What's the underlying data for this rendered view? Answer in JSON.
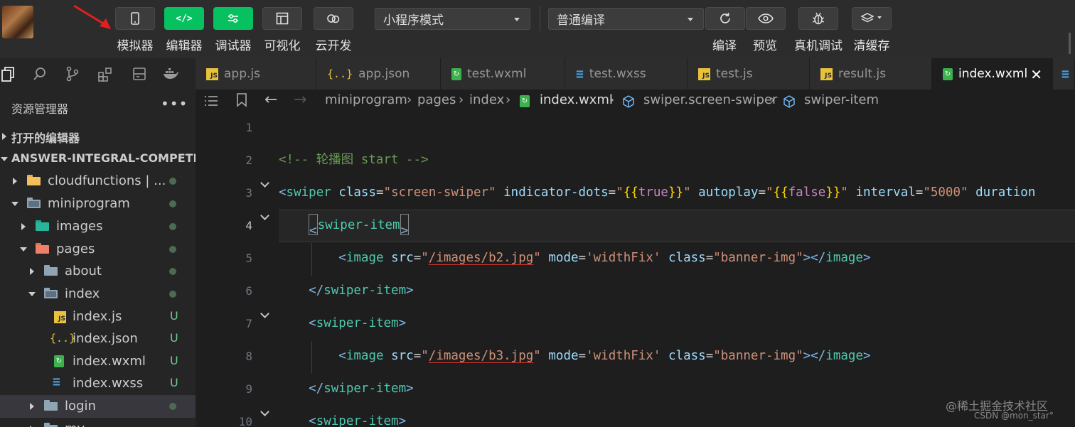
{
  "toolbar": {
    "buttons": [
      {
        "label": "模拟器",
        "icon": "phone-icon",
        "style": "gray"
      },
      {
        "label": "编辑器",
        "icon": "code-icon",
        "style": "green"
      },
      {
        "label": "调试器",
        "icon": "debugger-icon",
        "style": "green"
      },
      {
        "label": "可视化",
        "icon": "layout-icon",
        "style": "gray"
      },
      {
        "label": "云开发",
        "icon": "cloud-icon",
        "style": "gray"
      }
    ],
    "mode_select": "小程序模式",
    "compile_select": "普通编译",
    "actions": [
      {
        "label": "编译",
        "icon": "refresh-icon"
      },
      {
        "label": "预览",
        "icon": "eye-icon"
      },
      {
        "label": "真机调试",
        "icon": "bug-icon"
      },
      {
        "label": "清缓存",
        "icon": "layers-icon"
      }
    ]
  },
  "activity_icons": [
    "files-icon",
    "search-icon",
    "source-control-icon",
    "extensions-icon",
    "storage-icon",
    "docker-icon"
  ],
  "tabs": [
    {
      "label": "app.js",
      "type": "js"
    },
    {
      "label": "app.json",
      "type": "json"
    },
    {
      "label": "test.wxml",
      "type": "wxml"
    },
    {
      "label": "test.wxss",
      "type": "wxss"
    },
    {
      "label": "test.js",
      "type": "js"
    },
    {
      "label": "result.js",
      "type": "js"
    },
    {
      "label": "index.wxml",
      "type": "wxml",
      "active": true,
      "close": "✕"
    }
  ],
  "sidebar": {
    "title": "资源管理器",
    "more": "•••",
    "open_editors": "打开的编辑器",
    "project": "ANSWER-INTEGRAL-COMPETITI...",
    "tree": [
      {
        "label": "cloudfunctions | ...",
        "status": "dot"
      },
      {
        "label": "miniprogram",
        "status": "dot"
      },
      {
        "label": "images",
        "status": "dot"
      },
      {
        "label": "pages",
        "status": "dot"
      },
      {
        "label": "about",
        "status": "dot"
      },
      {
        "label": "index",
        "status": "dot"
      },
      {
        "label": "index.js",
        "status": "U"
      },
      {
        "label": "index.json",
        "status": "U"
      },
      {
        "label": "index.wxml",
        "status": "U"
      },
      {
        "label": "index.wxss",
        "status": "U"
      },
      {
        "label": "login",
        "status": "dot"
      },
      {
        "label": "my",
        "status": ""
      }
    ]
  },
  "breadcrumb": [
    "miniprogram",
    "pages",
    "index",
    "index.wxml",
    "swiper.screen-swiper",
    "swiper-item"
  ],
  "editor": {
    "line_numbers": [
      "1",
      "2",
      "3",
      "4",
      "5",
      "6",
      "7",
      "8",
      "9",
      "10"
    ],
    "current_line": "4"
  },
  "watermark": {
    "site": "@稀土掘金技术社区",
    "author": "CSDN @mon_star°"
  }
}
